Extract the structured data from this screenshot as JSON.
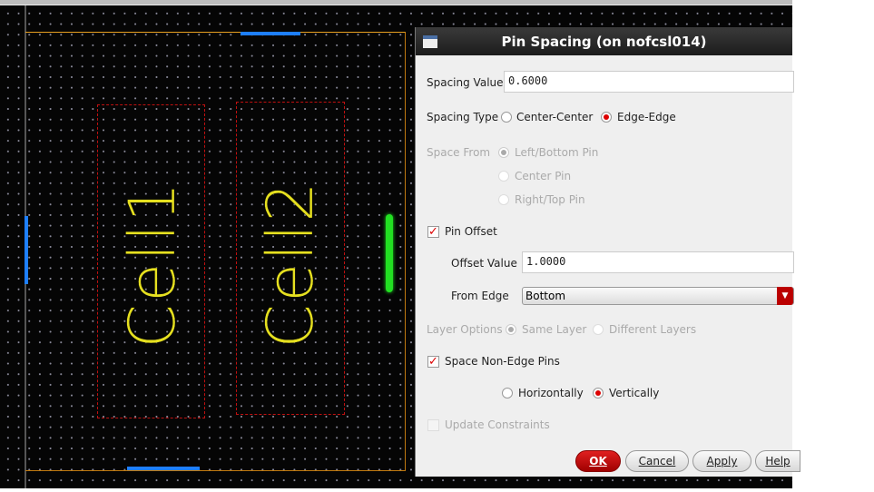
{
  "canvas": {
    "cells": [
      {
        "label": "Cell1"
      },
      {
        "label": "Cell2"
      }
    ]
  },
  "dialog": {
    "title": "Pin Spacing (on nofcsl014)",
    "spacing_value_label": "Spacing Value",
    "spacing_value": "0.6000",
    "spacing_type_label": "Spacing Type",
    "spacing_type_options": [
      "Center-Center",
      "Edge-Edge"
    ],
    "spacing_type_selected": "Edge-Edge",
    "space_from_label": "Space From",
    "space_from_options": [
      "Left/Bottom Pin",
      "Center Pin",
      "Right/Top Pin"
    ],
    "pin_offset_label": "Pin Offset",
    "pin_offset_checked": true,
    "offset_value_label": "Offset Value",
    "offset_value": "1.0000",
    "from_edge_label": "From Edge",
    "from_edge_value": "Bottom",
    "layer_options_label": "Layer Options",
    "layer_options": [
      "Same Layer",
      "Different Layers"
    ],
    "space_non_edge_label": "Space Non-Edge Pins",
    "space_non_edge_checked": true,
    "direction_options": [
      "Horizontally",
      "Vertically"
    ],
    "direction_selected": "Vertically",
    "update_constraints_label": "Update Constraints",
    "buttons": {
      "ok": "OK",
      "cancel": "Cancel",
      "apply": "Apply",
      "help": "Help"
    }
  }
}
